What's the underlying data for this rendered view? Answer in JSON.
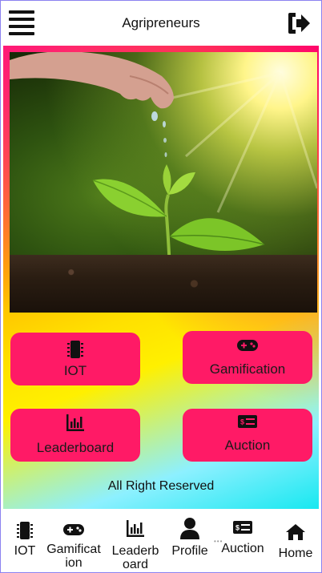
{
  "header": {
    "title": "Agripreneurs",
    "menu_icon": "hamburger-menu-icon",
    "logout_icon": "logout-icon"
  },
  "hero": {
    "image": "hand watering a seedling in soil",
    "content": "Agripreneurs"
  },
  "buttons": [
    {
      "id": "iot",
      "label": "IOT",
      "icon": "chip-icon"
    },
    {
      "id": "gamification",
      "label": "Gamification",
      "icon": "gamepad-icon"
    },
    {
      "id": "leaderboard",
      "label": "Leaderboard",
      "icon": "bar-chart-icon"
    },
    {
      "id": "auction",
      "label": "Auction",
      "icon": "money-bill-icon"
    }
  ],
  "footer": {
    "text": "All Right Reserved"
  },
  "bottom_nav": [
    {
      "label": "IOT",
      "icon": "chip-icon"
    },
    {
      "label": "Gamificat\nion",
      "icon": "gamepad-icon"
    },
    {
      "label": "Leaderb\noard",
      "icon": "bar-chart-icon"
    },
    {
      "label": "Profile",
      "icon": "user-icon"
    },
    {
      "label": "Auction",
      "icon": "money-bill-icon"
    },
    {
      "label": "Home",
      "icon": "home-icon"
    }
  ],
  "colors": {
    "button": "#ff1a66",
    "accent_pink": "#ff2a6e",
    "accent_yellow": "#ffe000",
    "accent_cyan": "#18e8f0"
  }
}
